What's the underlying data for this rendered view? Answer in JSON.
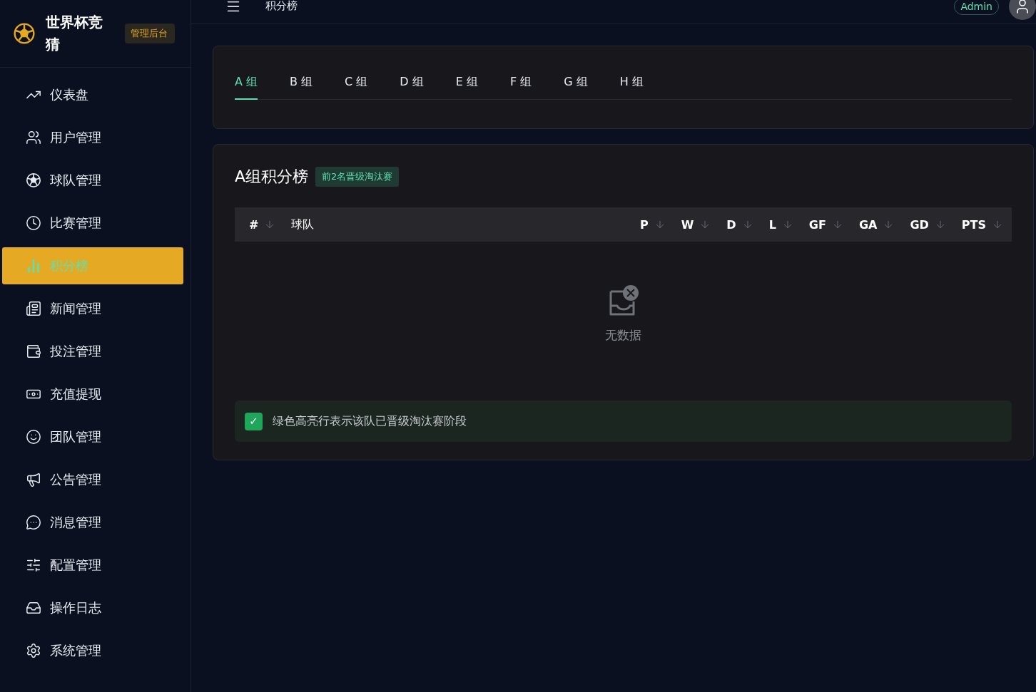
{
  "brand": {
    "title": "世界杯竞猜",
    "badge": "管理后台"
  },
  "sidebar": {
    "items": [
      {
        "label": "仪表盘",
        "selected": false
      },
      {
        "label": "用户管理",
        "selected": false
      },
      {
        "label": "球队管理",
        "selected": false
      },
      {
        "label": "比赛管理",
        "selected": false
      },
      {
        "label": "积分榜",
        "selected": true
      },
      {
        "label": "新闻管理",
        "selected": false
      },
      {
        "label": "投注管理",
        "selected": false
      },
      {
        "label": "充值提现",
        "selected": false
      },
      {
        "label": "团队管理",
        "selected": false
      },
      {
        "label": "公告管理",
        "selected": false
      },
      {
        "label": "消息管理",
        "selected": false
      },
      {
        "label": "配置管理",
        "selected": false
      },
      {
        "label": "操作日志",
        "selected": false
      },
      {
        "label": "系统管理",
        "selected": false
      }
    ]
  },
  "header": {
    "title": "积分榜",
    "user_badge": "Admin"
  },
  "tabs": [
    {
      "label": "A 组",
      "selected": true
    },
    {
      "label": "B 组",
      "selected": false
    },
    {
      "label": "C 组",
      "selected": false
    },
    {
      "label": "D 组",
      "selected": false
    },
    {
      "label": "E 组",
      "selected": false
    },
    {
      "label": "F 组",
      "selected": false
    },
    {
      "label": "G 组",
      "selected": false
    },
    {
      "label": "H 组",
      "selected": false
    }
  ],
  "standings": {
    "title": "A组积分榜",
    "tag": "前2名晋级淘汰赛",
    "columns": [
      "#",
      "球队",
      "P",
      "W",
      "D",
      "L",
      "GF",
      "GA",
      "GD",
      "PTS"
    ],
    "empty_text": "无数据",
    "legend": {
      "mark": "✓",
      "text": "绿色高亮行表示该队已晋级淘汰赛阶段"
    }
  }
}
